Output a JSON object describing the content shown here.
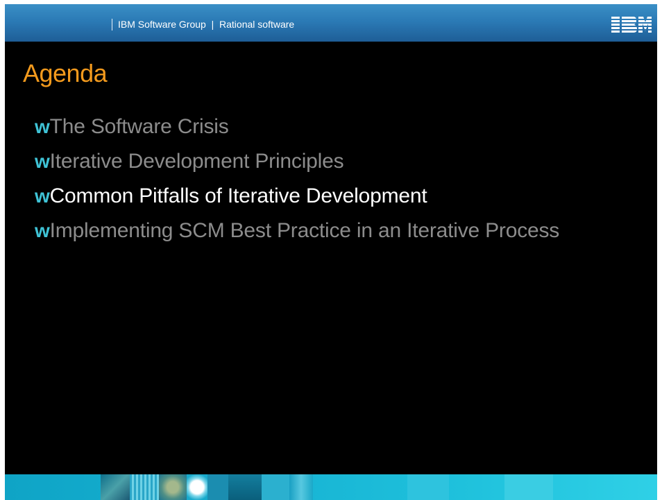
{
  "header": {
    "text": "IBM Software Group  |  Rational software",
    "logo": "IBM",
    "bar_color": "#2b7ab5"
  },
  "title": "Agenda",
  "bullet_glyph": "w",
  "agenda": [
    {
      "text": "The Software Crisis",
      "highlighted": false
    },
    {
      "text": "Iterative Development Principles",
      "highlighted": false
    },
    {
      "text": "Common Pitfalls of Iterative Development",
      "highlighted": true
    },
    {
      "text": "Implementing SCM Best Practice in an Iterative Process",
      "highlighted": false
    }
  ],
  "colors": {
    "background": "#000000",
    "title": "#f39a1d",
    "bullet": "#3fc3d6",
    "item_dim": "#8c8c8c",
    "item_current": "#ffffff"
  }
}
